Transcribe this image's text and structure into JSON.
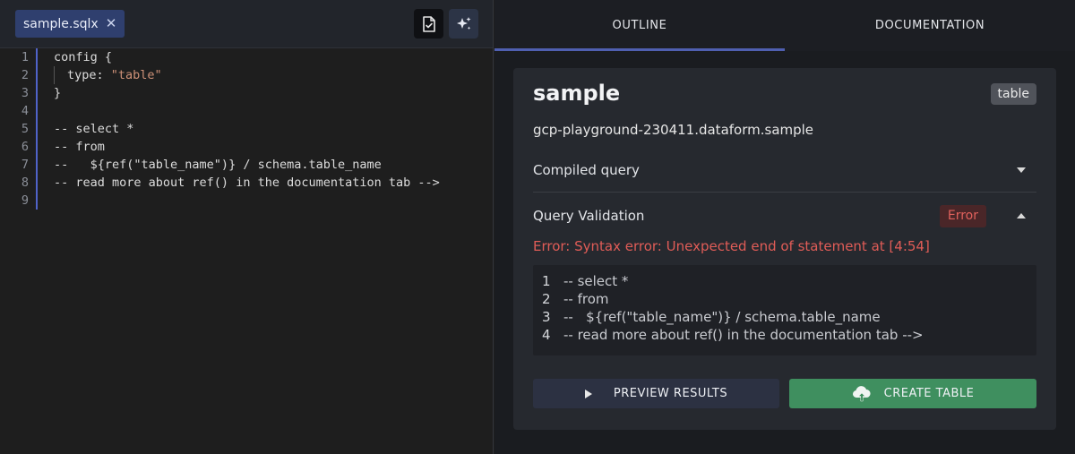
{
  "editor": {
    "file_tab": {
      "label": "sample.sqlx",
      "close": "✕"
    },
    "toolbar": {
      "compile_icon": "file-check-icon",
      "ai_icon": "sparkles-icon"
    },
    "lines": [
      {
        "n": "1",
        "text": "config {"
      },
      {
        "n": "2",
        "key": "type: ",
        "value": "\"table\""
      },
      {
        "n": "3",
        "text": "}"
      },
      {
        "n": "4",
        "text": ""
      },
      {
        "n": "5",
        "comment": "-- select *"
      },
      {
        "n": "6",
        "comment": "-- from"
      },
      {
        "n": "7",
        "comment": "--   ${ref(\"table_name\")} / schema.table_name"
      },
      {
        "n": "8",
        "comment": "-- read more about ref() in the documentation tab -->"
      },
      {
        "n": "9",
        "text": ""
      }
    ]
  },
  "panel": {
    "tabs": [
      {
        "label": "OUTLINE",
        "active": true
      },
      {
        "label": "DOCUMENTATION",
        "active": false
      }
    ],
    "card": {
      "title": "sample",
      "type_badge": "table",
      "fqn": "gcp-playground-230411.dataform.sample",
      "compiled_query_label": "Compiled query",
      "validation_label": "Query Validation",
      "validation_status": "Error",
      "error_message": "Error: Syntax error: Unexpected end of statement at [4:54]",
      "snippet": [
        {
          "n": "1",
          "text": "-- select *"
        },
        {
          "n": "2",
          "text": "-- from"
        },
        {
          "n": "3",
          "text": "--   ${ref(\"table_name\")} / schema.table_name"
        },
        {
          "n": "4",
          "text": "-- read more about ref() in the documentation tab -->"
        }
      ],
      "preview_button": "PREVIEW RESULTS",
      "create_button": "CREATE TABLE"
    }
  },
  "colors": {
    "accent": "#4f5fb0",
    "error": "#e05c57",
    "success": "#3f8f5f",
    "string": "#ce9178",
    "comment": "#6a9955"
  }
}
